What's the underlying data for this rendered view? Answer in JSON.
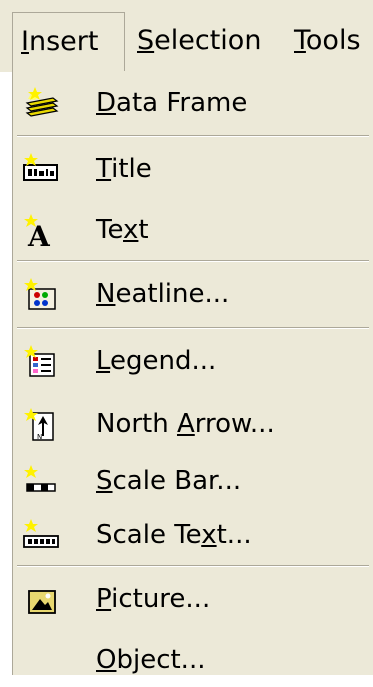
{
  "menubar": {
    "items": [
      {
        "label": "Insert",
        "mnemonic_index": 0
      },
      {
        "label": "Selection",
        "mnemonic_index": 0
      },
      {
        "label": "Tools",
        "mnemonic_index": 0
      }
    ]
  },
  "menu": {
    "items": [
      {
        "label": "Data Frame",
        "mnemonic_index": 0,
        "icon": "data-frame-icon"
      },
      {
        "label": "Title",
        "mnemonic_index": 0,
        "icon": "title-icon"
      },
      {
        "label": "Text",
        "mnemonic_index": 2,
        "icon": "text-icon"
      },
      {
        "label": "Neatline...",
        "mnemonic_index": 0,
        "icon": "neatline-icon"
      },
      {
        "label": "Legend...",
        "mnemonic_index": 0,
        "icon": "legend-icon"
      },
      {
        "label": "North Arrow...",
        "mnemonic_index": 6,
        "icon": "north-arrow-icon"
      },
      {
        "label": "Scale Bar...",
        "mnemonic_index": 0,
        "icon": "scale-bar-icon"
      },
      {
        "label": "Scale Text...",
        "mnemonic_index": 8,
        "icon": "scale-text-icon"
      },
      {
        "label": "Picture...",
        "mnemonic_index": 0,
        "icon": "picture-icon"
      },
      {
        "label": "Object...",
        "mnemonic_index": 0,
        "icon": "none"
      }
    ]
  },
  "colors": {
    "menu_background": "#ECE9D8",
    "separator_shadow": "#ACA899",
    "separator_highlight": "#FFFFFF",
    "text": "#000000"
  }
}
